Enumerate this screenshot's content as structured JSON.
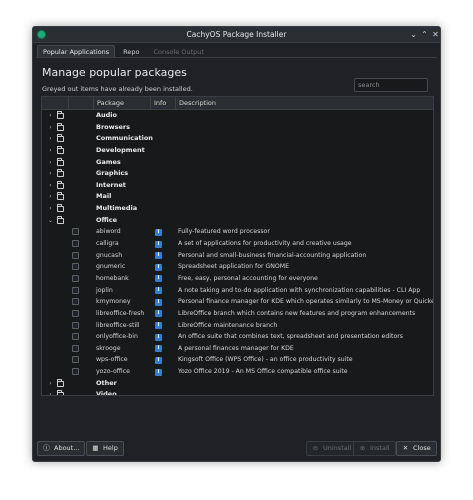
{
  "window": {
    "title": "CachyOS Package Installer"
  },
  "window_controls": {
    "dropdown": "⌄",
    "minimize": "⌃",
    "close": "✕"
  },
  "tabs": [
    {
      "label": "Popular Applications",
      "state": "active"
    },
    {
      "label": "Repo",
      "state": "normal"
    },
    {
      "label": "Console Output",
      "state": "disabled"
    }
  ],
  "page": {
    "heading": "Manage popular packages",
    "note": "Greyed out items have already been installed."
  },
  "search": {
    "placeholder": "search",
    "value": ""
  },
  "table": {
    "columns": [
      "",
      "",
      "Package",
      "Info",
      "Description"
    ],
    "categories_before": [
      {
        "label": "Audio",
        "expanded": false
      },
      {
        "label": "Browsers",
        "expanded": false
      },
      {
        "label": "Communication",
        "expanded": false
      },
      {
        "label": "Development",
        "expanded": false
      },
      {
        "label": "Games",
        "expanded": false
      },
      {
        "label": "Graphics",
        "expanded": false
      },
      {
        "label": "Internet",
        "expanded": false
      },
      {
        "label": "Mail",
        "expanded": false
      },
      {
        "label": "Multimedia",
        "expanded": false
      }
    ],
    "expanded_category": {
      "label": "Office",
      "expanded": true
    },
    "packages": [
      {
        "name": "abiword",
        "description": "Fully-featured word processor"
      },
      {
        "name": "calligra",
        "description": "A set of applications for productivity and creative usage"
      },
      {
        "name": "gnucash",
        "description": "Personal and small-business financial-accounting application"
      },
      {
        "name": "gnumeric",
        "description": "Spreadsheet application for GNOME"
      },
      {
        "name": "homebank",
        "description": "Free, easy, personal accounting for everyone"
      },
      {
        "name": "joplin",
        "description": "A note taking and to-do application with synchronization capabilities - CLI App"
      },
      {
        "name": "kmymoney",
        "description": "Personal finance manager for KDE which operates similarly to MS-Money or Quicken"
      },
      {
        "name": "libreoffice-fresh",
        "description": "LibreOffice branch which contains new features and program enhancements"
      },
      {
        "name": "libreoffice-still",
        "description": "LibreOffice maintenance branch"
      },
      {
        "name": "onlyoffice-bin",
        "description": "An office suite that combines text, spreadsheet and presentation editors"
      },
      {
        "name": "skrooge",
        "description": "A personal finances manager for KDE"
      },
      {
        "name": "wps-office",
        "description": "Kingsoft Office (WPS Office) - an office productivity suite"
      },
      {
        "name": "yozo-office",
        "description": "Yozo Office 2019 - An MS Office compatible office suite"
      }
    ],
    "categories_after": [
      {
        "label": "Other",
        "expanded": false
      },
      {
        "label": "Video",
        "expanded": false
      },
      {
        "label": "Virtualization",
        "expanded": false
      }
    ],
    "info_glyph": "i",
    "collapsed_glyph": "›",
    "expanded_glyph": "⌄"
  },
  "buttons": {
    "about": {
      "label": "About...",
      "icon": "info-circle-icon",
      "glyph": "ⓘ"
    },
    "help": {
      "label": "Help",
      "icon": "grid-help-icon",
      "glyph": "▦"
    },
    "uninstall": {
      "label": "Uninstall",
      "icon": "minus-circle-icon",
      "glyph": "⊖",
      "enabled": false
    },
    "install": {
      "label": "Install",
      "icon": "plus-circle-icon",
      "glyph": "⊕",
      "enabled": false
    },
    "close": {
      "label": "Close",
      "icon": "close-icon",
      "glyph": "✕"
    }
  },
  "colors": {
    "background": "#1f2124",
    "tree_bg": "#17191b",
    "info_badge": "#2f7fd8",
    "app_icon": "#1faa7a"
  }
}
